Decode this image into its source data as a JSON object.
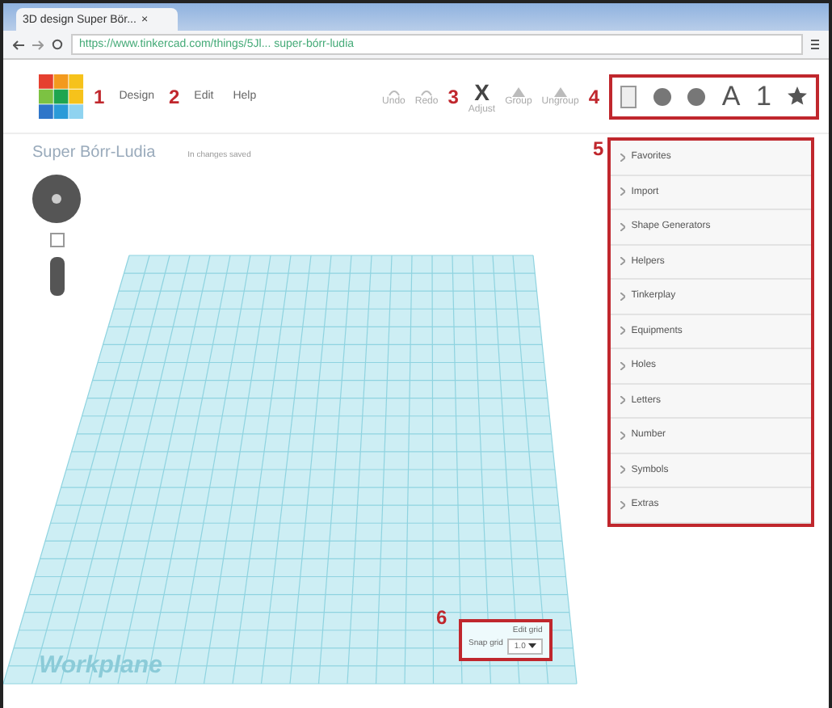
{
  "browser": {
    "tab_title": "3D design Super Bör...",
    "close": "×",
    "url": "https://www.tinkercad.com/things/5Jl... super-bórr-ludia"
  },
  "toolbar": {
    "menus": [
      {
        "marker": "1",
        "label": "Design"
      },
      {
        "marker": "2",
        "label": "Edit"
      },
      {
        "label": "Help"
      }
    ],
    "actions": [
      {
        "label": "Undo"
      },
      {
        "label": "Redo"
      }
    ],
    "adjust_marker": "3",
    "adjust": {
      "icon": "X",
      "label": "Adjust"
    },
    "group_actions": [
      {
        "label": "Group"
      },
      {
        "label": "Ungroup"
      }
    ],
    "view_marker": "4",
    "views": [
      {
        "kind": "page"
      },
      {
        "kind": "ball"
      },
      {
        "kind": "ball"
      },
      {
        "kind": "text",
        "text": "A"
      },
      {
        "kind": "text",
        "text": "1"
      },
      {
        "kind": "star"
      }
    ]
  },
  "design": {
    "title": "Super Bórr-Ludia",
    "subtitle": "In changes saved"
  },
  "library_marker": "5",
  "library": [
    "Favorites",
    "Import",
    "Shape Generators",
    "Helpers",
    "Tinkerplay",
    "Equipments",
    "Holes",
    "Letters",
    "Number",
    "Symbols",
    "Extras"
  ],
  "grid_marker": "6",
  "grid": {
    "edit": "Edit grid",
    "label": "Snap grid",
    "value": "1.0"
  },
  "workplane": "Workplane"
}
